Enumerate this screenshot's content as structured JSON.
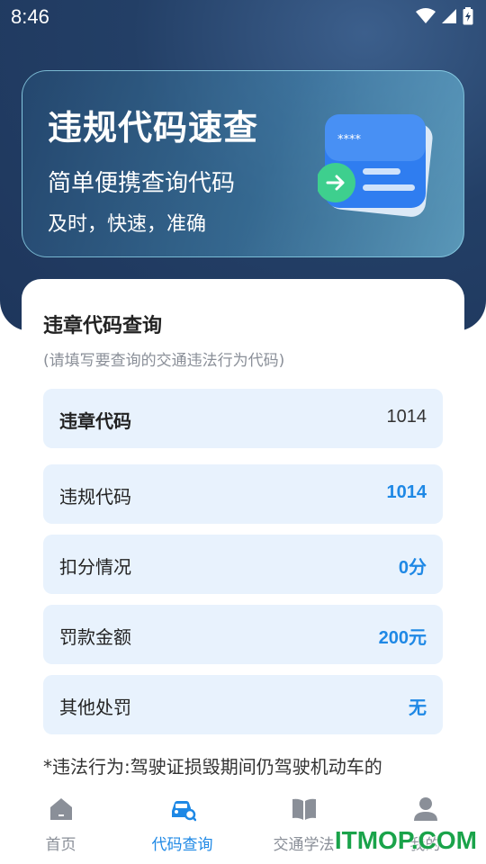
{
  "status_bar": {
    "time": "8:46"
  },
  "hero": {
    "title": "违规代码速查",
    "subtitle": "简单便携查询代码",
    "tagline": "及时，快速，准确",
    "illustration_stars": "****"
  },
  "query": {
    "title": "违章代码查询",
    "hint": "(请填写要查询的交通违法行为代码)",
    "input": {
      "label": "违章代码",
      "value": "1014"
    },
    "results": [
      {
        "label": "违规代码",
        "value": "1014"
      },
      {
        "label": "扣分情况",
        "value": "0分"
      },
      {
        "label": "罚款金额",
        "value": "200元"
      },
      {
        "label": "其他处罚",
        "value": "无"
      }
    ],
    "note": "*违法行为:驾驶证损毁期间仍驾驶机动车的"
  },
  "nav": {
    "items": [
      {
        "label": "首页",
        "icon": "home-icon"
      },
      {
        "label": "代码查询",
        "icon": "car-search-icon"
      },
      {
        "label": "交通学法",
        "icon": "book-icon"
      },
      {
        "label": "我的",
        "icon": "user-icon"
      }
    ],
    "active_color": "#1e88e5",
    "inactive_color": "#8a8f98"
  },
  "watermark": "ITMOP.COM"
}
